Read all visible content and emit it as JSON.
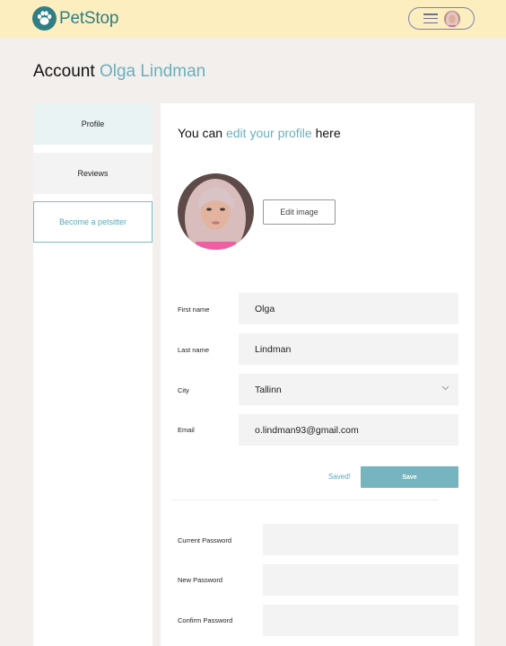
{
  "app": {
    "name": "PetStop",
    "brand_color": "#2f7f84",
    "accent_color": "#6ab0bd",
    "header_bg": "#fdeec0"
  },
  "header": {
    "menu_icon": "hamburger-icon",
    "avatar_icon": "user-avatar"
  },
  "page": {
    "title_prefix": "Account",
    "title_name": "Olga Lindman"
  },
  "sidebar": {
    "items": [
      {
        "label": "Profile",
        "state": "active"
      },
      {
        "label": "Reviews",
        "state": "default"
      },
      {
        "label": "Become a petsitter",
        "state": "outlined"
      }
    ]
  },
  "profile": {
    "heading_prefix": "You can",
    "heading_accent": "edit your profile",
    "heading_suffix": "here",
    "edit_image_label": "Edit image",
    "fields": {
      "first_name": {
        "label": "First name",
        "value": "Olga"
      },
      "last_name": {
        "label": "Last name",
        "value": "Lindman"
      },
      "city": {
        "label": "City",
        "value": "Tallinn"
      },
      "email": {
        "label": "Email",
        "value": "o.lindman93@gmail.com"
      }
    },
    "saved_text": "Saved!",
    "save_label": "Save"
  },
  "password": {
    "current_label": "Current Password",
    "new_label": "New Password",
    "confirm_label": "Confirm Password"
  }
}
